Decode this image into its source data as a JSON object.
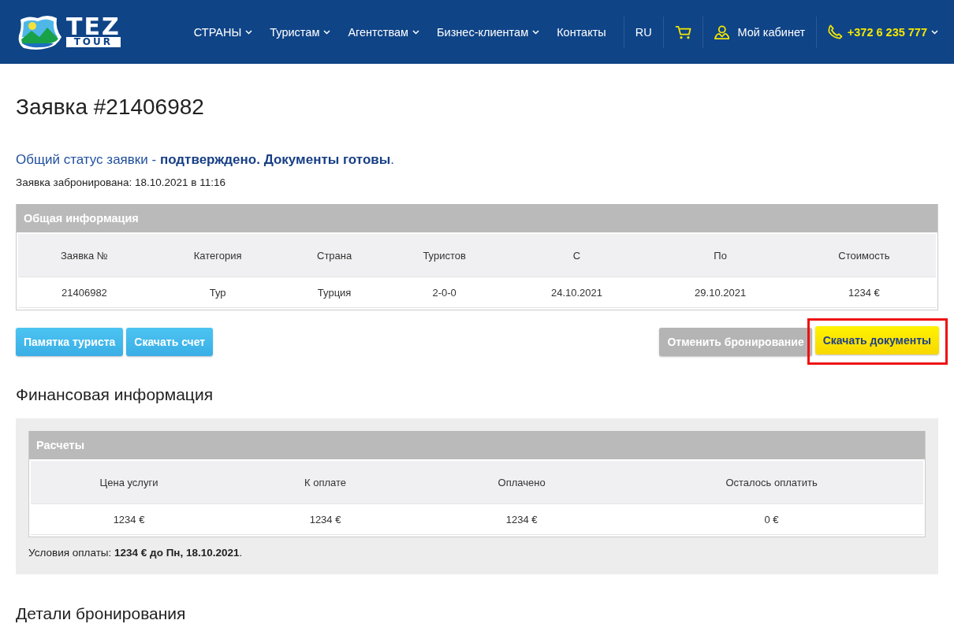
{
  "header": {
    "logo": {
      "top": "TEZ",
      "bottom": "TOUR"
    },
    "nav": [
      {
        "label": "СТРАНЫ",
        "has_menu": true
      },
      {
        "label": "Туристам",
        "has_menu": true
      },
      {
        "label": "Агентствам",
        "has_menu": true
      },
      {
        "label": "Бизнес-клиентам",
        "has_menu": true
      },
      {
        "label": "Контакты",
        "has_menu": false
      }
    ],
    "language": "RU",
    "account": "Мой кабинет",
    "phone": "+372 6 235 777"
  },
  "title": "Заявка #21406982",
  "status": "Общий статус заявки - **подтверждено. Документы готовы**.",
  "booked": "Заявка забронирована: 18.10.2021 в 11:16",
  "general_info": {
    "title": "Общая информация",
    "columns": [
      "Заявка №",
      "Категория",
      "Страна",
      "Туристов",
      "С",
      "По",
      "Стоимость"
    ],
    "rows": [
      [
        "21406982",
        "Тур",
        "Турция",
        "2-0-0",
        "24.10.2021",
        "29.10.2021",
        "1234 €"
      ]
    ]
  },
  "buttons": [
    {
      "label": "Памятка туриста",
      "kind": "info",
      "highlighted": false
    },
    {
      "label": "Скачать счет",
      "kind": "info",
      "highlighted": false
    },
    {
      "label": "Отменить бронирование",
      "kind": "disabled",
      "highlighted": false
    },
    {
      "label": "Скачать документы",
      "kind": "primary",
      "highlighted": true
    }
  ],
  "finance": {
    "heading": "Финансовая информация",
    "title": "Расчеты",
    "columns": [
      "Цена услуги",
      "К оплате",
      "Оплачено",
      "Осталось оплатить"
    ],
    "rows": [
      [
        "1234 €",
        "1234 €",
        "1234 €",
        "0 €"
      ]
    ],
    "terms": "Условия оплаты: **1234 € до Пн, 18.10.2021**."
  },
  "details_heading": "Детали бронирования"
}
